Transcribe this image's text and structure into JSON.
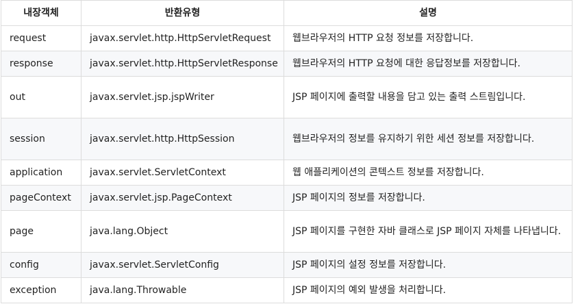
{
  "table": {
    "headers": [
      "내장객체",
      "반환유형",
      "설명"
    ],
    "rows": [
      {
        "name": "request",
        "type": "javax.servlet.http.HttpServletRequest",
        "desc": "웹브라우저의 HTTP 요청 정보를 저장합니다."
      },
      {
        "name": "response",
        "type": "javax.servlet.http.HttpServletResponse",
        "desc": "웹브라우저의 HTTP 요청에 대한 응답정보를 저장합니다."
      },
      {
        "name": "out",
        "type": "javax.servlet.jsp.jspWriter",
        "desc": "JSP 페이지에 출력할 내용을 담고 있는 출력 스트림입니다."
      },
      {
        "name": "session",
        "type": "javax.servlet.http.HttpSession",
        "desc": "웹브라우저의 정보를 유지하기 위한 세션 정보를 저장합니다."
      },
      {
        "name": "application",
        "type": "javax.servlet.ServletContext",
        "desc": "웹 애플리케이션의 콘텍스트 정보를 저장합니다."
      },
      {
        "name": "pageContext",
        "type": "javax.servlet.jsp.PageContext",
        "desc": "JSP 페이지의 정보를 저장합니다."
      },
      {
        "name": "page",
        "type": "java.lang.Object",
        "desc": "JSP 페이지를 구현한 자바 클래스로 JSP 페이지 자체를 나타냅니다."
      },
      {
        "name": "config",
        "type": "javax.servlet.ServletConfig",
        "desc": "JSP 페이지의 설정 정보를 저장합니다."
      },
      {
        "name": "exception",
        "type": "java.lang.Throwable",
        "desc": "JSP 페이지의 예외 발생을 처리합니다."
      }
    ]
  }
}
